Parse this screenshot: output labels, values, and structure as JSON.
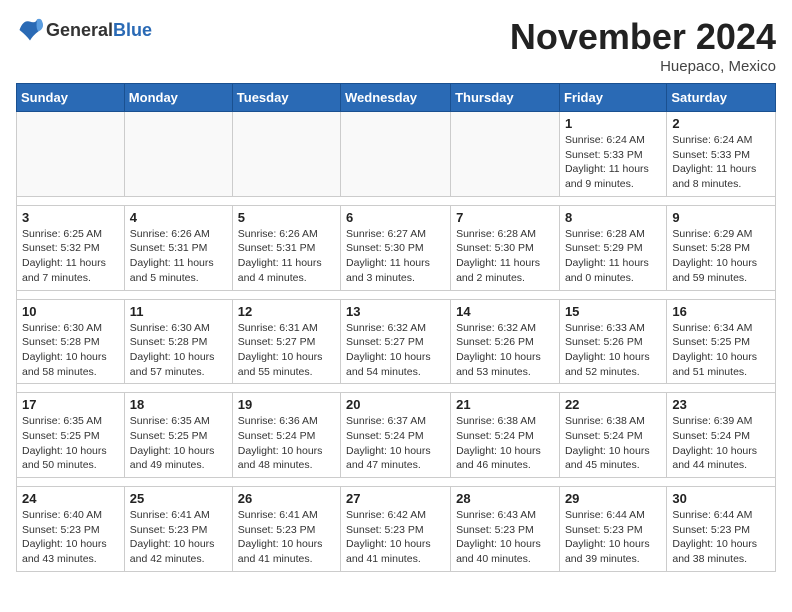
{
  "header": {
    "logo_general": "General",
    "logo_blue": "Blue",
    "month_title": "November 2024",
    "location": "Huepaco, Mexico"
  },
  "weekdays": [
    "Sunday",
    "Monday",
    "Tuesday",
    "Wednesday",
    "Thursday",
    "Friday",
    "Saturday"
  ],
  "weeks": [
    [
      {
        "day": "",
        "info": ""
      },
      {
        "day": "",
        "info": ""
      },
      {
        "day": "",
        "info": ""
      },
      {
        "day": "",
        "info": ""
      },
      {
        "day": "",
        "info": ""
      },
      {
        "day": "1",
        "info": "Sunrise: 6:24 AM\nSunset: 5:33 PM\nDaylight: 11 hours and 9 minutes."
      },
      {
        "day": "2",
        "info": "Sunrise: 6:24 AM\nSunset: 5:33 PM\nDaylight: 11 hours and 8 minutes."
      }
    ],
    [
      {
        "day": "3",
        "info": "Sunrise: 6:25 AM\nSunset: 5:32 PM\nDaylight: 11 hours and 7 minutes."
      },
      {
        "day": "4",
        "info": "Sunrise: 6:26 AM\nSunset: 5:31 PM\nDaylight: 11 hours and 5 minutes."
      },
      {
        "day": "5",
        "info": "Sunrise: 6:26 AM\nSunset: 5:31 PM\nDaylight: 11 hours and 4 minutes."
      },
      {
        "day": "6",
        "info": "Sunrise: 6:27 AM\nSunset: 5:30 PM\nDaylight: 11 hours and 3 minutes."
      },
      {
        "day": "7",
        "info": "Sunrise: 6:28 AM\nSunset: 5:30 PM\nDaylight: 11 hours and 2 minutes."
      },
      {
        "day": "8",
        "info": "Sunrise: 6:28 AM\nSunset: 5:29 PM\nDaylight: 11 hours and 0 minutes."
      },
      {
        "day": "9",
        "info": "Sunrise: 6:29 AM\nSunset: 5:28 PM\nDaylight: 10 hours and 59 minutes."
      }
    ],
    [
      {
        "day": "10",
        "info": "Sunrise: 6:30 AM\nSunset: 5:28 PM\nDaylight: 10 hours and 58 minutes."
      },
      {
        "day": "11",
        "info": "Sunrise: 6:30 AM\nSunset: 5:28 PM\nDaylight: 10 hours and 57 minutes."
      },
      {
        "day": "12",
        "info": "Sunrise: 6:31 AM\nSunset: 5:27 PM\nDaylight: 10 hours and 55 minutes."
      },
      {
        "day": "13",
        "info": "Sunrise: 6:32 AM\nSunset: 5:27 PM\nDaylight: 10 hours and 54 minutes."
      },
      {
        "day": "14",
        "info": "Sunrise: 6:32 AM\nSunset: 5:26 PM\nDaylight: 10 hours and 53 minutes."
      },
      {
        "day": "15",
        "info": "Sunrise: 6:33 AM\nSunset: 5:26 PM\nDaylight: 10 hours and 52 minutes."
      },
      {
        "day": "16",
        "info": "Sunrise: 6:34 AM\nSunset: 5:25 PM\nDaylight: 10 hours and 51 minutes."
      }
    ],
    [
      {
        "day": "17",
        "info": "Sunrise: 6:35 AM\nSunset: 5:25 PM\nDaylight: 10 hours and 50 minutes."
      },
      {
        "day": "18",
        "info": "Sunrise: 6:35 AM\nSunset: 5:25 PM\nDaylight: 10 hours and 49 minutes."
      },
      {
        "day": "19",
        "info": "Sunrise: 6:36 AM\nSunset: 5:24 PM\nDaylight: 10 hours and 48 minutes."
      },
      {
        "day": "20",
        "info": "Sunrise: 6:37 AM\nSunset: 5:24 PM\nDaylight: 10 hours and 47 minutes."
      },
      {
        "day": "21",
        "info": "Sunrise: 6:38 AM\nSunset: 5:24 PM\nDaylight: 10 hours and 46 minutes."
      },
      {
        "day": "22",
        "info": "Sunrise: 6:38 AM\nSunset: 5:24 PM\nDaylight: 10 hours and 45 minutes."
      },
      {
        "day": "23",
        "info": "Sunrise: 6:39 AM\nSunset: 5:24 PM\nDaylight: 10 hours and 44 minutes."
      }
    ],
    [
      {
        "day": "24",
        "info": "Sunrise: 6:40 AM\nSunset: 5:23 PM\nDaylight: 10 hours and 43 minutes."
      },
      {
        "day": "25",
        "info": "Sunrise: 6:41 AM\nSunset: 5:23 PM\nDaylight: 10 hours and 42 minutes."
      },
      {
        "day": "26",
        "info": "Sunrise: 6:41 AM\nSunset: 5:23 PM\nDaylight: 10 hours and 41 minutes."
      },
      {
        "day": "27",
        "info": "Sunrise: 6:42 AM\nSunset: 5:23 PM\nDaylight: 10 hours and 41 minutes."
      },
      {
        "day": "28",
        "info": "Sunrise: 6:43 AM\nSunset: 5:23 PM\nDaylight: 10 hours and 40 minutes."
      },
      {
        "day": "29",
        "info": "Sunrise: 6:44 AM\nSunset: 5:23 PM\nDaylight: 10 hours and 39 minutes."
      },
      {
        "day": "30",
        "info": "Sunrise: 6:44 AM\nSunset: 5:23 PM\nDaylight: 10 hours and 38 minutes."
      }
    ]
  ]
}
